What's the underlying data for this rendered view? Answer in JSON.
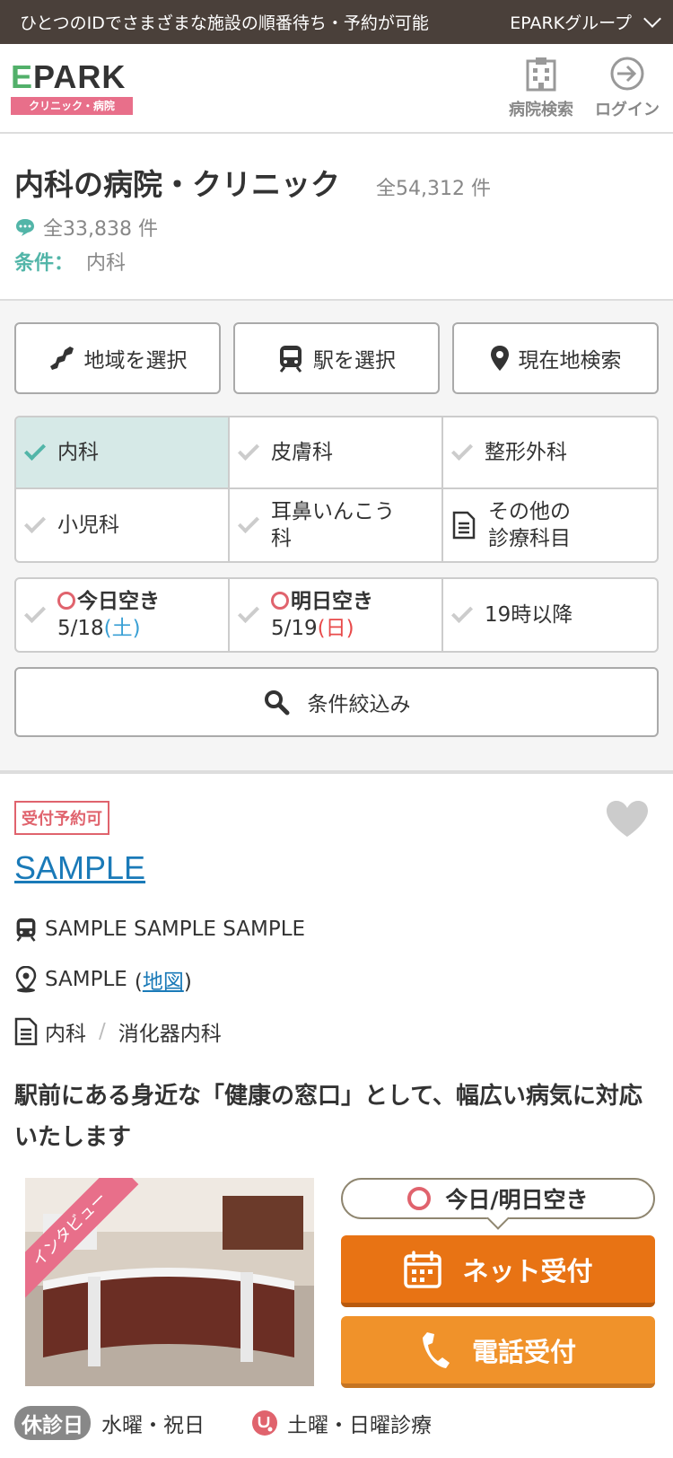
{
  "topbar": {
    "message": "ひとつのIDでさまざまな施設の順番待ち・予約が可能",
    "group_label": "EPARKグループ"
  },
  "header": {
    "logo_word_e": "E",
    "logo_word_rest": "PARK",
    "logo_sub": "クリニック・病院",
    "hospital_search_label": "病院検索",
    "login_label": "ログイン"
  },
  "page": {
    "title": "内科の病院・クリニック",
    "total_count": "全54,312 件",
    "review_count": "全33,838 件",
    "condition_key": "条件：",
    "condition_value": "内科"
  },
  "filters": {
    "area_label": "地域を選択",
    "station_label": "駅を選択",
    "current_label": "現在地検索",
    "departments": [
      {
        "label": "内科",
        "selected": true
      },
      {
        "label": "皮膚科",
        "selected": false
      },
      {
        "label": "整形外科",
        "selected": false
      },
      {
        "label": "小児科",
        "selected": false
      },
      {
        "label": "耳鼻いんこう科",
        "selected": false
      },
      {
        "label": "その他の診療科目",
        "selected": false
      }
    ],
    "other_line1": "その他の",
    "other_line2": "診療科目",
    "ent_line1": "耳鼻いんこう",
    "ent_line2": "科",
    "today_title": "今日空き",
    "today_date": "5/18",
    "today_day": "(土)",
    "tomorrow_title": "明日空き",
    "tomorrow_date": "5/19",
    "tomorrow_day": "(日)",
    "evening_label": "19時以降",
    "narrow_label": "条件絞込み"
  },
  "listing": {
    "badge": "受付予約可",
    "name": "SAMPLE",
    "station": "SAMPLE SAMPLE SAMPLE",
    "address": "SAMPLE",
    "map_link": "地図",
    "dept1": "内科",
    "dept2": "消化器内科",
    "description": "駅前にある身近な「健康の窓口」として、幅広い病気に対応いたします",
    "photo_ribbon": "インタビュー",
    "availability": "今日/明日空き",
    "net_label": "ネット受付",
    "tel_label": "電話受付",
    "closed_tag": "休診日",
    "closed_days": "水曜・祝日",
    "weekend": "土曜・日曜診療"
  },
  "colors": {
    "accent": "#52b5a8",
    "brand_pink": "#e86f8a",
    "link": "#1a7ab8",
    "net_orange": "#e87314",
    "tel_orange": "#f0922a"
  }
}
